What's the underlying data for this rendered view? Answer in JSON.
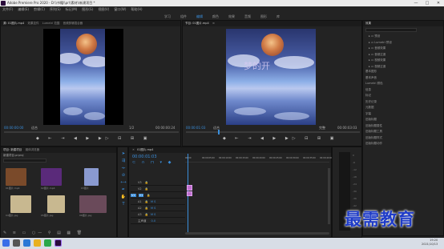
{
  "titlebar": {
    "title": "Adobe Premiere Pro 2020 - D:\\\\书籍\\\\pr\\\\素材\\\\新建项目 *",
    "minimize": "—",
    "maximize": "□",
    "close": "✕"
  },
  "menu": [
    "文件(F)",
    "编辑(E)",
    "剪辑(C)",
    "序列(S)",
    "标记(M)",
    "图形(G)",
    "视图(V)",
    "窗口(W)",
    "帮助(H)"
  ],
  "workspaces": [
    {
      "label": "学习",
      "active": false
    },
    {
      "label": "组件",
      "active": false
    },
    {
      "label": "编辑",
      "active": true
    },
    {
      "label": "颜色",
      "active": false
    },
    {
      "label": "效果",
      "active": false
    },
    {
      "label": "音频",
      "active": false
    },
    {
      "label": "图形",
      "active": false
    },
    {
      "label": "库",
      "active": false
    }
  ],
  "source_panel": {
    "tabs": [
      "源: 01图片.mp4",
      "效果控件",
      "Lumetri 范围",
      "音频剪辑混合器"
    ],
    "timecode_in": "00:00:00:00",
    "fit": "适合",
    "fraction": "1/2",
    "timecode_dur": "00:00:00:24"
  },
  "program_panel": {
    "tabs": [
      "节目: 01图片.mp4",
      "≡"
    ],
    "timecode_in": "00:00:01:03",
    "fit": "适合",
    "fraction": "完整",
    "timecode_dur": "00:00:03:03",
    "overlay_text": "梦的开"
  },
  "project_panel": {
    "tabs": [
      "项目: 新建项目",
      "媒体浏览器"
    ],
    "path": "新建项目.prproj",
    "items": [
      {
        "label": "01图片.mp4",
        "sub": "5:00",
        "color": "#7a4a2a"
      },
      {
        "label": "02图片.mp4",
        "sub": "5:00",
        "color": "#5a2a7a"
      },
      {
        "label": "03图片",
        "sub": "5:00",
        "color": "#8a9ad0"
      },
      {
        "label": "04图片.jpg",
        "sub": "5:00",
        "color": "#c8b890"
      },
      {
        "label": "05图片.jpg",
        "sub": "5:00",
        "color": "#c8b890"
      },
      {
        "label": "06图片.jpg",
        "sub": "5:00",
        "color": "#6a4a5a"
      }
    ]
  },
  "timeline": {
    "tab": "01图片.mp4",
    "timecode": "00:00:01:03",
    "ruler": [
      "00:00",
      "00:00:05:00",
      "00:00:10:00",
      "00:00:15:00",
      "00:00:20:00",
      "00:00:25:00",
      "00:00:30:00",
      "00:00:35:00",
      "00:00:40:00"
    ],
    "video_tracks": [
      "V3",
      "V2",
      "V1"
    ],
    "audio_tracks": [
      "A1",
      "A2",
      "A3"
    ],
    "master": "主声道",
    "master_val": "0.0"
  },
  "effects_panel": {
    "title": "效果",
    "folders": [
      "预设",
      "Lumetri 预设",
      "音频效果",
      "音频过渡",
      "视频效果",
      "视频过渡"
    ],
    "sections": [
      "基本图形",
      "基本声音",
      "Lumetri 颜色",
      "信息",
      "标记",
      "历史记录",
      "元数据",
      "字幕",
      "旧版标题",
      "旧版标题属性",
      "旧版标题工具",
      "旧版标题样式",
      "旧版标题动作"
    ]
  },
  "taskbar": {
    "time": "19:20",
    "date": "2021/10/13"
  },
  "watermark": "最需教育",
  "colors": {
    "accent": "#3a8edb",
    "clip": "#c070d0",
    "watermark": "#1f3cc8"
  }
}
